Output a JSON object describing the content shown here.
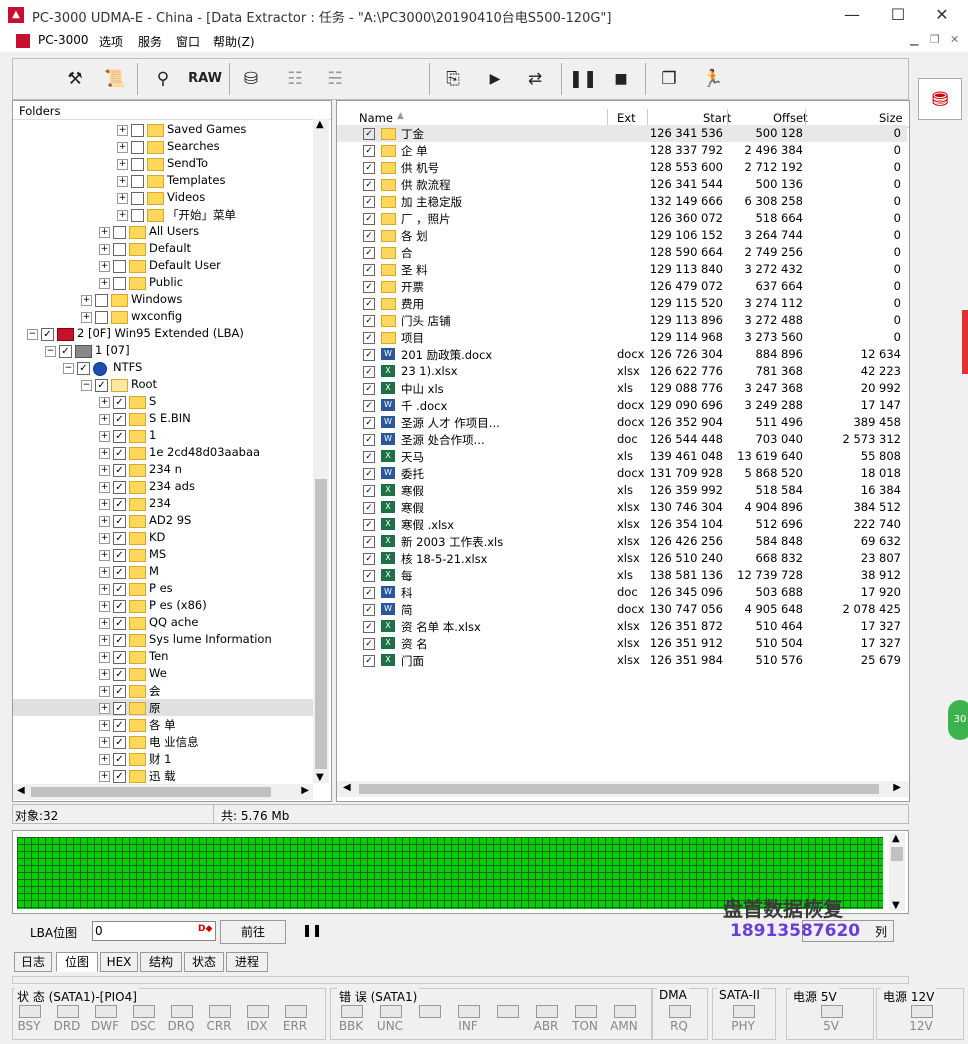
{
  "window": {
    "title": "PC-3000 UDMA-E - China - [Data Extractor : 任务 - \"A:\\PC3000\\20190410台电S500-120G\"]",
    "app_icon": "pc3000-icon",
    "controls": [
      "—",
      "☐",
      "✕"
    ]
  },
  "menu": [
    "PC-3000",
    "选项",
    "服务",
    "窗口",
    "帮助(Z)"
  ],
  "toolbar": {
    "raw_label": "RAW"
  },
  "folders_panel": {
    "header": "Folders",
    "rows": [
      {
        "indent": 7,
        "checked": false,
        "label": "Saved Games"
      },
      {
        "indent": 7,
        "checked": false,
        "label": "Searches"
      },
      {
        "indent": 7,
        "checked": false,
        "label": "SendTo"
      },
      {
        "indent": 7,
        "checked": false,
        "label": "Templates"
      },
      {
        "indent": 7,
        "checked": false,
        "label": "Videos"
      },
      {
        "indent": 7,
        "checked": false,
        "label": "「开始」菜单"
      },
      {
        "indent": 6,
        "checked": false,
        "label": "All Users"
      },
      {
        "indent": 6,
        "checked": false,
        "label": "Default"
      },
      {
        "indent": 6,
        "checked": false,
        "label": "Default User"
      },
      {
        "indent": 6,
        "checked": false,
        "label": "Public"
      },
      {
        "indent": 5,
        "checked": false,
        "label": "Windows"
      },
      {
        "indent": 5,
        "checked": false,
        "label": "wxconfig"
      },
      {
        "indent": 2,
        "checked": true,
        "label": "2 [0F] Win95 Extended  (LBA)",
        "kind": "partition"
      },
      {
        "indent": 3,
        "checked": true,
        "label": "1 [07]",
        "kind": "disk"
      },
      {
        "indent": 4,
        "checked": true,
        "label": "NTFS",
        "kind": "fs"
      },
      {
        "indent": 5,
        "checked": true,
        "label": "Root",
        "kind": "root"
      },
      {
        "indent": 6,
        "checked": true,
        "label": "S"
      },
      {
        "indent": 6,
        "checked": true,
        "label": "S          E.BIN"
      },
      {
        "indent": 6,
        "checked": true,
        "label": "1"
      },
      {
        "indent": 6,
        "checked": true,
        "label": "1e           2cd48d03aabaa"
      },
      {
        "indent": 6,
        "checked": true,
        "label": "234         n"
      },
      {
        "indent": 6,
        "checked": true,
        "label": "234         ads"
      },
      {
        "indent": 6,
        "checked": true,
        "label": "234"
      },
      {
        "indent": 6,
        "checked": true,
        "label": "AD2          9S"
      },
      {
        "indent": 6,
        "checked": true,
        "label": "KD"
      },
      {
        "indent": 6,
        "checked": true,
        "label": "MS"
      },
      {
        "indent": 6,
        "checked": true,
        "label": "M"
      },
      {
        "indent": 6,
        "checked": true,
        "label": "P             es"
      },
      {
        "indent": 6,
        "checked": true,
        "label": "P             es (x86)"
      },
      {
        "indent": 6,
        "checked": true,
        "label": "QQ           ache"
      },
      {
        "indent": 6,
        "checked": true,
        "label": "Sys          lume Information"
      },
      {
        "indent": 6,
        "checked": true,
        "label": "Ten"
      },
      {
        "indent": 6,
        "checked": true,
        "label": "We"
      },
      {
        "indent": 6,
        "checked": true,
        "label": "会"
      },
      {
        "indent": 6,
        "checked": true,
        "label": "原",
        "selected": true
      },
      {
        "indent": 6,
        "checked": true,
        "label": "各           单"
      },
      {
        "indent": 6,
        "checked": true,
        "label": "电           业信息"
      },
      {
        "indent": 6,
        "checked": true,
        "label": "财           1"
      },
      {
        "indent": 6,
        "checked": true,
        "label": "迅           载"
      }
    ]
  },
  "files_panel": {
    "columns": [
      "Name",
      "Ext",
      "Start",
      "Offset",
      "Size"
    ],
    "rows": [
      {
        "type": "folder",
        "name": "丁金",
        "ext": "",
        "start": "126 341 536",
        "offset": "500 128",
        "size": "0"
      },
      {
        "type": "folder",
        "name": "企          单",
        "ext": "",
        "start": "128 337 792",
        "offset": "2 496 384",
        "size": "0"
      },
      {
        "type": "folder",
        "name": "供           机号",
        "ext": "",
        "start": "128 553 600",
        "offset": "2 712 192",
        "size": "0"
      },
      {
        "type": "folder",
        "name": "供           款流程",
        "ext": "",
        "start": "126 341 544",
        "offset": "500 136",
        "size": "0"
      },
      {
        "type": "folder",
        "name": "加           主稳定版",
        "ext": "",
        "start": "132 149 666",
        "offset": "6 308 258",
        "size": "0"
      },
      {
        "type": "folder",
        "name": "厂           ，照片",
        "ext": "",
        "start": "126 360 072",
        "offset": "518 664",
        "size": "0"
      },
      {
        "type": "folder",
        "name": "各           划",
        "ext": "",
        "start": "129 106 152",
        "offset": "3 264 744",
        "size": "0"
      },
      {
        "type": "folder",
        "name": "合",
        "ext": "",
        "start": "128 590 664",
        "offset": "2 749 256",
        "size": "0"
      },
      {
        "type": "folder",
        "name": "圣           料",
        "ext": "",
        "start": "129 113 840",
        "offset": "3 272 432",
        "size": "0"
      },
      {
        "type": "folder",
        "name": "开票",
        "ext": "",
        "start": "126 479 072",
        "offset": "637 664",
        "size": "0"
      },
      {
        "type": "folder",
        "name": "费用",
        "ext": "",
        "start": "129 115 520",
        "offset": "3 274 112",
        "size": "0"
      },
      {
        "type": "folder",
        "name": "门头          店铺",
        "ext": "",
        "start": "129 113 896",
        "offset": "3 272 488",
        "size": "0"
      },
      {
        "type": "folder",
        "name": "项目",
        "ext": "",
        "start": "129 114 968",
        "offset": "3 273 560",
        "size": "0"
      },
      {
        "type": "word",
        "name": "201                励政策.docx",
        "ext": "docx",
        "start": "126 726 304",
        "offset": "884 896",
        "size": "12 634"
      },
      {
        "type": "excel",
        "name": "23              1).xlsx",
        "ext": "xlsx",
        "start": "126 622 776",
        "offset": "781 368",
        "size": "42 223"
      },
      {
        "type": "excel",
        "name": "中山           xls",
        "ext": "xls",
        "start": "129 088 776",
        "offset": "3 247 368",
        "size": "20 992"
      },
      {
        "type": "word",
        "name": "千           .docx",
        "ext": "docx",
        "start": "129 090 696",
        "offset": "3 249 288",
        "size": "17 147"
      },
      {
        "type": "word",
        "name": "圣源           人才           作项目...",
        "ext": "docx",
        "start": "126 352 904",
        "offset": "511 496",
        "size": "389 458"
      },
      {
        "type": "word",
        "name": "圣源                     处合作项...",
        "ext": "doc",
        "start": "126 544 448",
        "offset": "703 040",
        "size": "2 573 312"
      },
      {
        "type": "excel",
        "name": "天马",
        "ext": "xls",
        "start": "139 461 048",
        "offset": "13 619 640",
        "size": "55 808"
      },
      {
        "type": "word",
        "name": "委托",
        "ext": "docx",
        "start": "131 709 928",
        "offset": "5 868 520",
        "size": "18 018"
      },
      {
        "type": "excel",
        "name": "寒假",
        "ext": "xls",
        "start": "126 359 992",
        "offset": "518 584",
        "size": "16 384"
      },
      {
        "type": "excel",
        "name": "寒假",
        "ext": "xlsx",
        "start": "130 746 304",
        "offset": "4 904 896",
        "size": "384 512"
      },
      {
        "type": "excel",
        "name": "寒假                     .xlsx",
        "ext": "xlsx",
        "start": "126 354 104",
        "offset": "512 696",
        "size": "222 740"
      },
      {
        "type": "excel",
        "name": "新                    2003 工作表.xls",
        "ext": "xlsx",
        "start": "126 426 256",
        "offset": "584 848",
        "size": "69 632"
      },
      {
        "type": "excel",
        "name": "核                   18-5-21.xlsx",
        "ext": "xlsx",
        "start": "126 510 240",
        "offset": "668 832",
        "size": "23 807"
      },
      {
        "type": "excel",
        "name": "每",
        "ext": "xls",
        "start": "138 581 136",
        "offset": "12 739 728",
        "size": "38 912"
      },
      {
        "type": "word",
        "name": "科",
        "ext": "doc",
        "start": "126 345 096",
        "offset": "503 688",
        "size": "17 920"
      },
      {
        "type": "word",
        "name": "简",
        "ext": "docx",
        "start": "130 747 056",
        "offset": "4 905 648",
        "size": "2 078 425"
      },
      {
        "type": "excel",
        "name": "资           名单      本.xlsx",
        "ext": "xlsx",
        "start": "126 351 872",
        "offset": "510 464",
        "size": "17 327"
      },
      {
        "type": "excel",
        "name": "资           名",
        "ext": "xlsx",
        "start": "126 351 912",
        "offset": "510 504",
        "size": "17 327"
      },
      {
        "type": "excel",
        "name": "门面",
        "ext": "xlsx",
        "start": "126 351 984",
        "offset": "510 576",
        "size": "25 679"
      }
    ]
  },
  "status": {
    "objects": "对象:32",
    "total": "共: 5.76 Mb"
  },
  "lba": {
    "label": "LBA位图",
    "value": "0",
    "go_label": "前往",
    "list_label": "列"
  },
  "tabs": [
    {
      "label": "日志",
      "active": false
    },
    {
      "label": "位图",
      "active": true
    },
    {
      "label": "HEX",
      "active": false
    },
    {
      "label": "结构",
      "active": false
    },
    {
      "label": "状态",
      "active": false
    },
    {
      "label": "进程",
      "active": false
    }
  ],
  "indicators": {
    "status_title": "状 态 (SATA1)-[PIO4]",
    "status_leds": [
      "BSY",
      "DRD",
      "DWF",
      "DSC",
      "DRQ",
      "CRR",
      "IDX",
      "ERR"
    ],
    "error_title": "错 误 (SATA1)",
    "error_leds": [
      "BBK",
      "UNC",
      "",
      "INF",
      "",
      "ABR",
      "TON",
      "AMN"
    ],
    "dma_title": "DMA",
    "dma_leds": [
      "RQ"
    ],
    "sata_title": "SATA-II",
    "sata_leds": [
      "PHY"
    ],
    "p5_title": "电源 5V",
    "p5_leds": [
      "5V"
    ],
    "p12_title": "电源 12V",
    "p12_leds": [
      "12V"
    ]
  },
  "watermark": {
    "line1": "盘首数据恢复",
    "line2": "18913587620"
  },
  "colors": {
    "lba_block": "#00d000",
    "accent_red": "#c8102e"
  }
}
